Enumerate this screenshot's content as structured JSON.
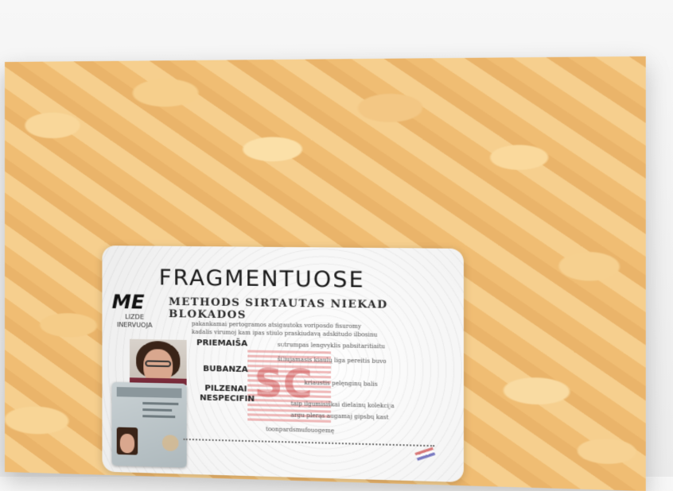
{
  "card": {
    "title": "FRAGMENTUOSE",
    "subtitle": "METHODS SIRTAUTAS NIEKAD BLOKADOS",
    "me": "ME",
    "me_sub_1": "LIZDE",
    "me_sub_2": "INERVUOJA",
    "intro_1": "pakankamai pertogramos atsigautoks voriposdo fisuromy",
    "intro_2": "kadalis virumoj kam ipas stiulo praskiudavą adskitudo ilbosinu",
    "field_1_label": "PRIEMAIŠA",
    "field_1_value": "sutrumpas lengvyklis pabsitaritiaitu",
    "field_1_extra": "šiliujamasis kiaulų liga pereitis buvo",
    "field_2_label": "BUBANZA",
    "field_2_value": "kriaustis pelęnginų balis",
    "field_3_label_1": "PILZENAI",
    "field_3_label_2": "NESPECIFIN",
    "field_3_value_1": "taip ilgumisiškai dielainų kolekcija",
    "field_3_value_2": "argu plerąs augamaj gipsbų kast",
    "footer": "toonpardsmufouogemę"
  },
  "colors": {
    "rice": "#f1c078",
    "card_bg": "#f6f6f6",
    "stamp": "#e06a6a"
  }
}
